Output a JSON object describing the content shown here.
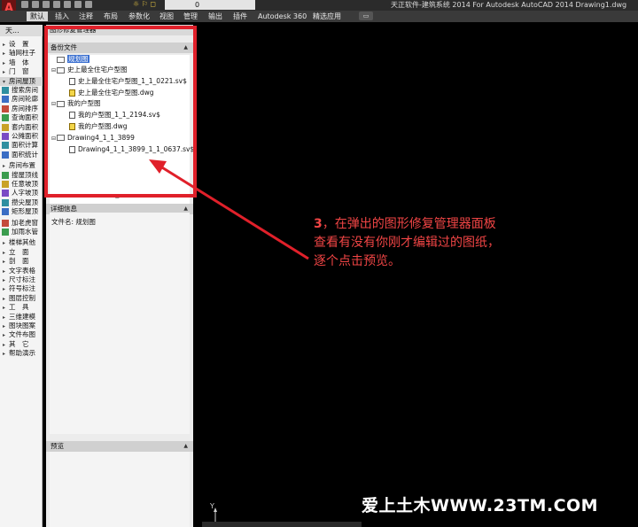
{
  "titlebar": {
    "app_letter": "A",
    "layer_value": "0",
    "title": "天正软件-建筑系统 2014  For Autodesk AutoCAD 2014   Drawing1.dwg"
  },
  "ribbon": {
    "tabs": [
      "默认",
      "插入",
      "注释",
      "布局",
      "参数化",
      "视图",
      "管理",
      "输出",
      "插件",
      "Autodesk 360",
      "精选应用"
    ]
  },
  "palette": {
    "header": "天...",
    "items": [
      {
        "label": "设　置",
        "kind": "group"
      },
      {
        "label": "轴网柱子",
        "kind": "group"
      },
      {
        "label": "墙　体",
        "kind": "group"
      },
      {
        "label": "门　窗",
        "kind": "group"
      },
      {
        "label": "房间屋顶",
        "kind": "open"
      },
      {
        "label": "搜索房间",
        "kind": "tool"
      },
      {
        "label": "房间轮廓",
        "kind": "tool"
      },
      {
        "label": "房间排序",
        "kind": "tool"
      },
      {
        "label": "查询面积",
        "kind": "tool"
      },
      {
        "label": "套内面积",
        "kind": "tool"
      },
      {
        "label": "公摊面积",
        "kind": "tool"
      },
      {
        "label": "面积计算",
        "kind": "tool"
      },
      {
        "label": "面积统计",
        "kind": "tool"
      },
      {
        "label": "房间布置",
        "kind": "group"
      },
      {
        "label": "搜屋顶线",
        "kind": "tool"
      },
      {
        "label": "任意坡顶",
        "kind": "tool"
      },
      {
        "label": "人字坡顶",
        "kind": "tool"
      },
      {
        "label": "攒尖屋顶",
        "kind": "tool"
      },
      {
        "label": "矩形屋顶",
        "kind": "tool"
      },
      {
        "label": "加老虎窗",
        "kind": "tool"
      },
      {
        "label": "加雨水管",
        "kind": "tool"
      },
      {
        "label": "楼梯其他",
        "kind": "group"
      },
      {
        "label": "立　面",
        "kind": "group"
      },
      {
        "label": "剖　面",
        "kind": "group"
      },
      {
        "label": "文字表格",
        "kind": "group"
      },
      {
        "label": "尺寸标注",
        "kind": "group"
      },
      {
        "label": "符号标注",
        "kind": "group"
      },
      {
        "label": "图层控制",
        "kind": "group"
      },
      {
        "label": "工　具",
        "kind": "group"
      },
      {
        "label": "三维建模",
        "kind": "group"
      },
      {
        "label": "图块图案",
        "kind": "group"
      },
      {
        "label": "文件布图",
        "kind": "group"
      },
      {
        "label": "其　它",
        "kind": "group"
      },
      {
        "label": "帮助演示",
        "kind": "group"
      }
    ]
  },
  "recovery_panel": {
    "title": "图形修复管理器",
    "backup_header": "备份文件",
    "tree": [
      {
        "label": "规划图",
        "level": 1,
        "icon": "folder",
        "selected": true
      },
      {
        "label": "史上最全住宅户型图",
        "level": 0,
        "icon": "folder",
        "selected": false
      },
      {
        "label": "史上最全住宅户型图_1_1_0221.sv$",
        "level": 2,
        "icon": "file",
        "selected": false
      },
      {
        "label": "史上最全住宅户型图.dwg",
        "level": 2,
        "icon": "dwg",
        "selected": false
      },
      {
        "label": "我的户型图",
        "level": 0,
        "icon": "folder",
        "selected": false
      },
      {
        "label": "我的户型图_1_1_2194.sv$",
        "level": 2,
        "icon": "file",
        "selected": false
      },
      {
        "label": "我的户型图.dwg",
        "level": 2,
        "icon": "dwg",
        "selected": false
      },
      {
        "label": "Drawing4_1_1_3899",
        "level": 0,
        "icon": "folder",
        "selected": false
      },
      {
        "label": "Drawing4_1_1_3899_1_1_0637.sv$",
        "level": 2,
        "icon": "file",
        "selected": false
      }
    ],
    "detail_header": "详细信息",
    "detail_text": "文件名: 规划图",
    "preview_header": "预览"
  },
  "annotation": {
    "number": "3",
    "line1": "，在弹出的图形修复管理器面板",
    "line2": "查看有没有你刚才编辑过的图纸，",
    "line3": "逐个点击预览。"
  },
  "ucs_label": "Y",
  "watermark": "爱上土木WWW.23TM.COM",
  "colors": {
    "highlight": "#e0202a",
    "canvas": "#000000",
    "selection": "#3a6fd0"
  }
}
